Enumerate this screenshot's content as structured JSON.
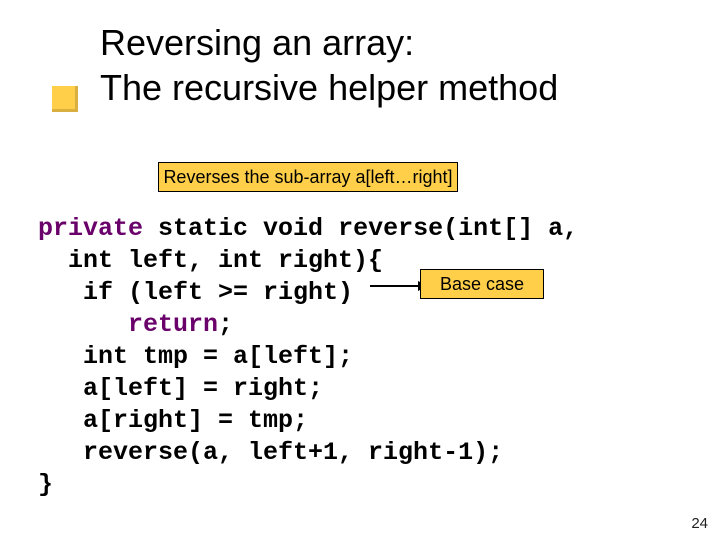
{
  "title": {
    "line1": "Reversing an array:",
    "line2": "The recursive helper method"
  },
  "caption1": "Reverses the sub-array a[left…right]",
  "caption2": "Base case",
  "code": {
    "l1_kw1": "private",
    "l1_rest": " static void reverse(int[] a,",
    "l2": "  int left, int right){",
    "l3": "   if (left >= right)",
    "l4_kw": "return",
    "l4_rest": ";",
    "l5": "   int tmp = a[left];",
    "l6": "   a[left] = right;",
    "l7": "   a[right] = tmp;",
    "l8": "   reverse(a, left+1, right-1);",
    "l9": "}"
  },
  "pagenum": "24"
}
